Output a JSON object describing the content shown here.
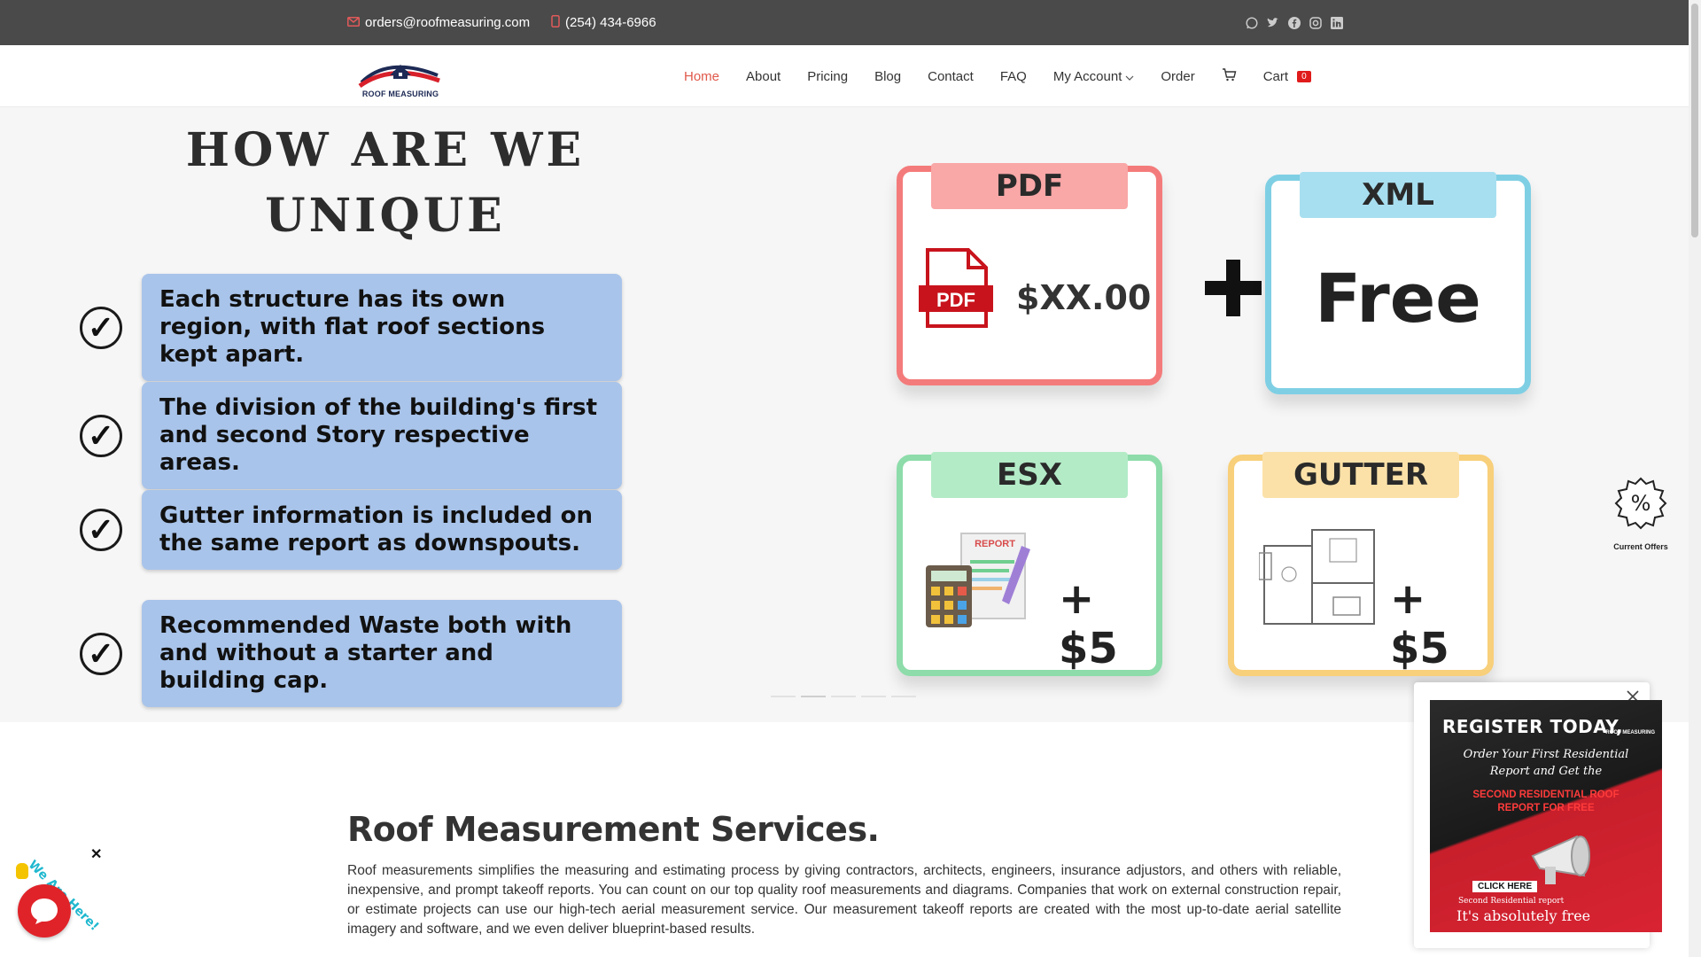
{
  "topbar": {
    "email": "orders@roofmeasuring.com",
    "phone": "(254) 434-6966",
    "social_icons": [
      "whatsapp-icon",
      "twitter-icon",
      "facebook-icon",
      "instagram-icon",
      "linkedin-icon"
    ]
  },
  "nav": {
    "logo_text": "ROOF MEASURING",
    "items": [
      {
        "label": "Home",
        "active": true
      },
      {
        "label": "About"
      },
      {
        "label": "Pricing"
      },
      {
        "label": "Blog"
      },
      {
        "label": "Contact"
      },
      {
        "label": "FAQ"
      },
      {
        "label": "My Account"
      },
      {
        "label": "Order"
      }
    ],
    "cart_label": "Cart",
    "cart_count": "0"
  },
  "hero": {
    "title_line1": "HOW ARE WE",
    "title_line2": "UNIQUE",
    "features": [
      "Each structure has its own region, with flat roof sections kept apart.",
      "The division of the building's first and second Story respective areas.",
      "Gutter information is included on the same report as downspouts.",
      "Recommended Waste both with and without a starter and building cap."
    ],
    "cards": {
      "pdf": {
        "tab": "PDF",
        "badge": "PDF",
        "price": "$XX.00"
      },
      "xml": {
        "tab": "XML",
        "price": "Free"
      },
      "esx": {
        "tab": "ESX",
        "report_label": "REPORT",
        "price": "+ $5"
      },
      "gutter": {
        "tab": "GUTTER",
        "price": "+ $5"
      }
    }
  },
  "offers": {
    "label": "Current Offers"
  },
  "section": {
    "title": "Roof Measurement Services.",
    "text": "Roof measurements simplifies the measuring and estimating process by giving contractors, architects, engineers, insurance adjustors, and others with reliable, inexpensive, and prompt takeoff reports. You can count on our top quality roof measurements and diagrams. Companies that work on external construction repair, or estimate projects can use our high-tech aerial measurement service. Our measurement takeoff reports are created with the most up-to-date aerial satellite imagery and software, and we even deliver blueprint-based results."
  },
  "popup": {
    "headline": "REGISTER TODAY,",
    "sub": "Order Your First Residential Report and Get the",
    "highlight": "SECOND RESIDENTIAL ROOF REPORT FOR FREE",
    "click": "CLICK HERE",
    "small": "Second Residential report",
    "free": "It's absolutely free",
    "logo_text": "ROOF MEASURING"
  },
  "chat": {
    "label": "We Are Here!"
  },
  "colors": {
    "accent": "#e0584a",
    "topbar": "#4a4a4a",
    "feature_box": "#a9c4ea",
    "chat": "#e02329"
  }
}
